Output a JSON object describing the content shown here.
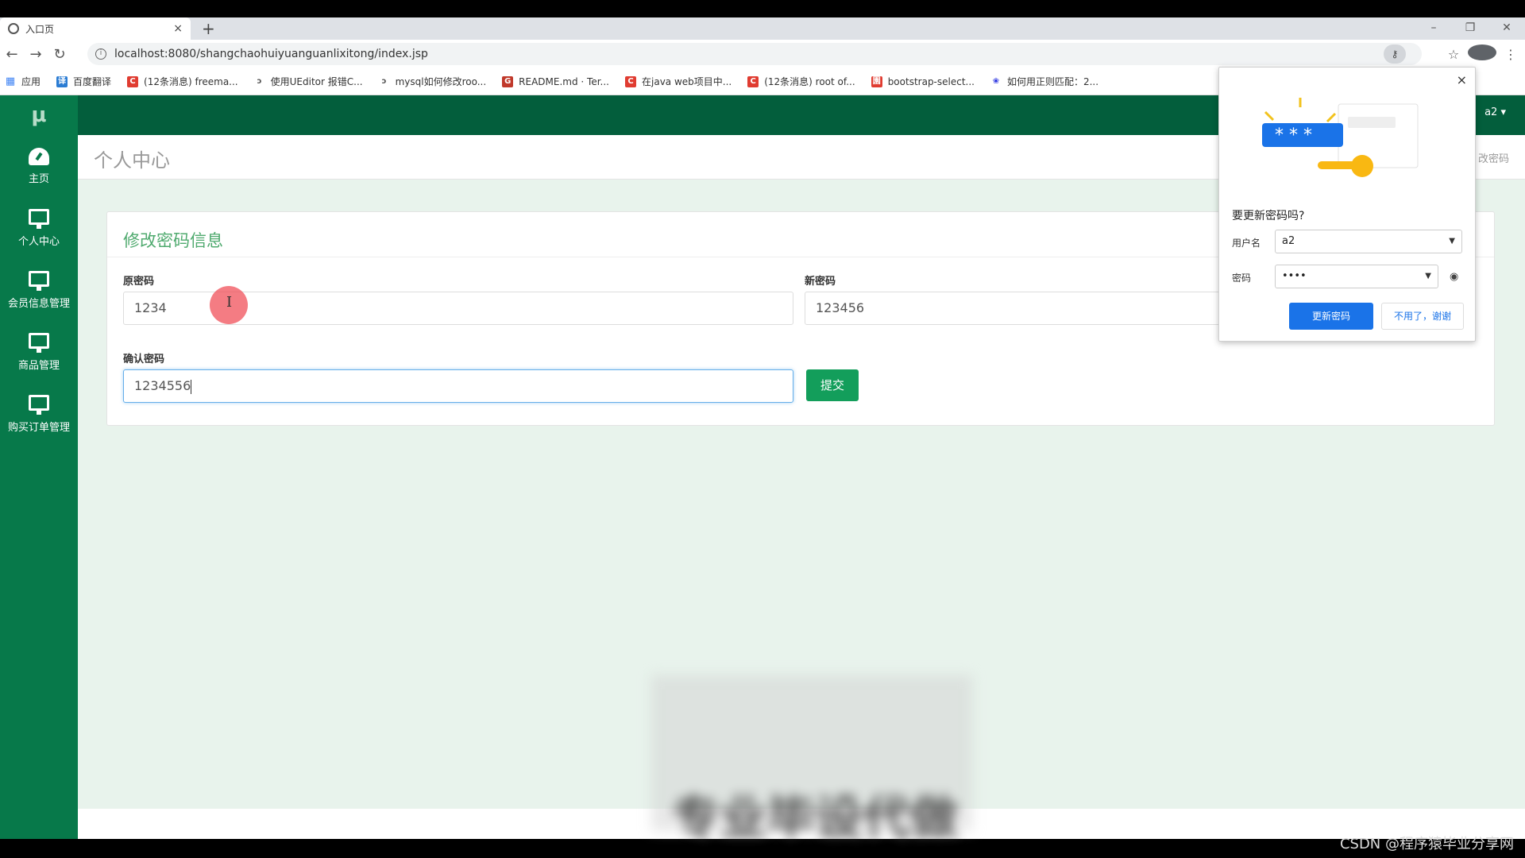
{
  "browser": {
    "tab_title": "入口页",
    "tab_close": "×",
    "new_tab": "+",
    "window_controls": [
      "–",
      "❐",
      "✕"
    ],
    "url": "localhost:8080/shangchaohuiyuanguanlixitong/index.jsp",
    "bookmarks": [
      {
        "label": "应用",
        "icon": "apps-grid-icon"
      },
      {
        "label": "百度翻译",
        "icon": "translate-icon"
      },
      {
        "label": "(12条消息) freema...",
        "icon": "csdn-icon"
      },
      {
        "label": "使用UEditor 报错C...",
        "icon": "page-icon"
      },
      {
        "label": "mysql如何修改roo...",
        "icon": "page-icon"
      },
      {
        "label": "README.md · Ter...",
        "icon": "gitee-icon"
      },
      {
        "label": "在java web项目中...",
        "icon": "csdn-icon"
      },
      {
        "label": "(12条消息) root of...",
        "icon": "csdn-icon"
      },
      {
        "label": "bootstrap-select...",
        "icon": "cnblogs-icon"
      },
      {
        "label": "如何用正则匹配：2...",
        "icon": "baidu-paw-icon"
      }
    ]
  },
  "app": {
    "logo": "μ",
    "user_menu": "a2 ▾",
    "breadcrumb": "改密码",
    "page_title": "个人中心",
    "sidebar": [
      {
        "label": "主页",
        "icon": "dashboard-icon"
      },
      {
        "label": "个人中心",
        "icon": "monitor-icon"
      },
      {
        "label": "会员信息管理",
        "icon": "monitor-icon"
      },
      {
        "label": "商品管理",
        "icon": "monitor-icon"
      },
      {
        "label": "购买订单管理",
        "icon": "monitor-icon"
      }
    ],
    "form": {
      "title": "修改密码信息",
      "old_password_label": "原密码",
      "old_password_value": "1234",
      "new_password_label": "新密码",
      "new_password_value": "123456",
      "confirm_password_label": "确认密码",
      "confirm_password_value": "1234556",
      "submit_label": "提交"
    }
  },
  "password_prompt": {
    "close": "×",
    "question": "要更新密码吗?",
    "username_label": "用户名",
    "username_value": "a2",
    "password_label": "密码",
    "password_value": "••••",
    "update_label": "更新密码",
    "decline_label": "不用了，谢谢",
    "illustration_text": "* * *"
  },
  "overlay": {
    "blurred_caption": "专业毕设代做",
    "watermark": "CSDN @程序猿毕业分享网"
  },
  "colors": {
    "sidebar": "#07794a",
    "topbar": "#035e3c",
    "accent_title": "#4faa6e",
    "submit": "#139e5b",
    "chrome_blue": "#1a73e8"
  }
}
